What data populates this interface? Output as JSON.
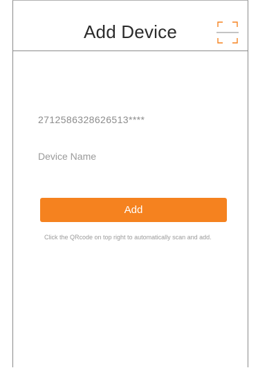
{
  "header": {
    "title": "Add Device",
    "scan_icon": "qr-scan-icon"
  },
  "form": {
    "serial_value": "2712586328626513****",
    "name_placeholder": "Device Name",
    "add_label": "Add",
    "hint": "Click the QRcode on top right to automatically scan and add."
  },
  "colors": {
    "accent": "#f5821f",
    "scan_icon": "#f5821f",
    "text_muted": "#8c8c8c"
  }
}
